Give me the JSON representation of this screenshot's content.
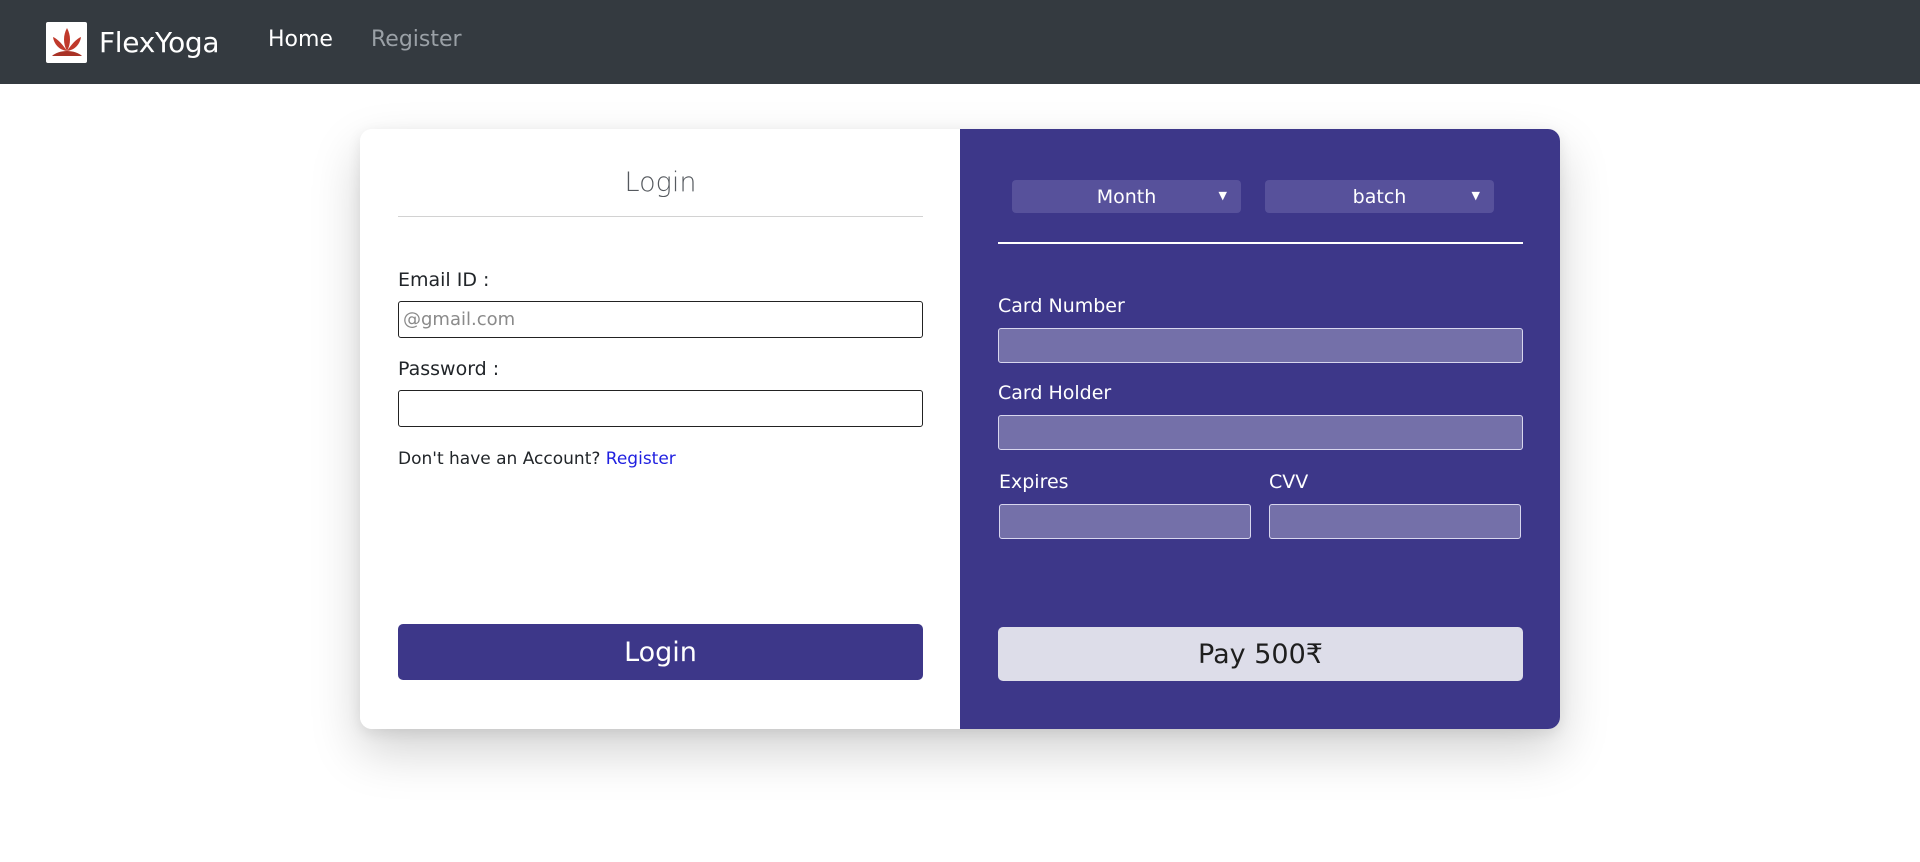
{
  "navbar": {
    "brand_name": "FlexYoga",
    "logo_icon": "lotus-icon",
    "links": [
      {
        "label": "Home",
        "active": true
      },
      {
        "label": "Register",
        "active": false
      }
    ]
  },
  "login": {
    "title": "Login",
    "email_label": "Email ID :",
    "email_placeholder": "@gmail.com",
    "email_value": "",
    "password_label": "Password :",
    "password_value": "",
    "account_prompt": "Don't have an Account?",
    "register_link": "Register",
    "button_label": "Login"
  },
  "payment": {
    "month_select": "Month",
    "batch_select": "batch",
    "card_number_label": "Card Number",
    "card_holder_label": "Card Holder",
    "expires_label": "Expires",
    "cvv_label": "CVV",
    "pay_button": "Pay 500₹"
  },
  "colors": {
    "navbar": "#343a40",
    "accent": "#3d3789",
    "input_fill": "#7470a9",
    "pay_button": "#dddde9",
    "link": "#1f1fe0"
  }
}
